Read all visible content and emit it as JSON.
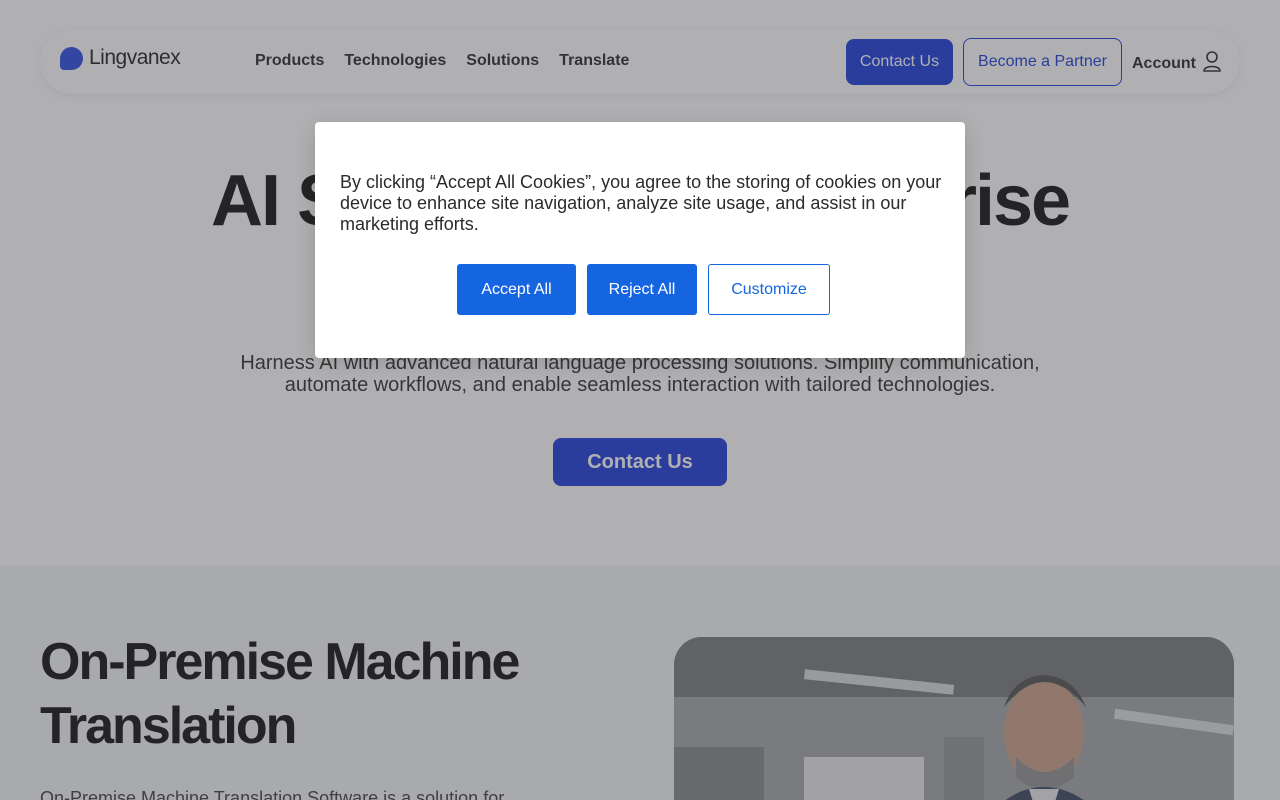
{
  "header": {
    "logo_text": "Lingvanex",
    "nav": [
      "Products",
      "Technologies",
      "Solutions",
      "Translate"
    ],
    "contact_label": "Contact Us",
    "partner_label": "Become a Partner",
    "account_label": "Account"
  },
  "hero": {
    "title": "AI Solutions for Enterprise",
    "subtitle": "Harness AI with advanced natural language processing solutions. Simplify communication, automate workflows, and enable seamless interaction with tailored technologies.",
    "cta_label": "Contact Us"
  },
  "section2": {
    "title": "On-Premise Machine Translation",
    "text": "On-Premise Machine Translation Software is a solution for"
  },
  "cookie": {
    "text": "By clicking “Accept All Cookies”, you agree to the storing of cookies on your device to enhance site navigation, analyze site usage, and assist in our marketing efforts.",
    "accept_label": "Accept All",
    "reject_label": "Reject All",
    "customize_label": "Customize"
  },
  "colors": {
    "brand": "#0b2ed8",
    "cookie_button": "#1565e0",
    "overlay": "rgba(80,80,85,0.45)"
  },
  "icons": {
    "account": "user-icon",
    "logo": "logo-mark-icon"
  }
}
